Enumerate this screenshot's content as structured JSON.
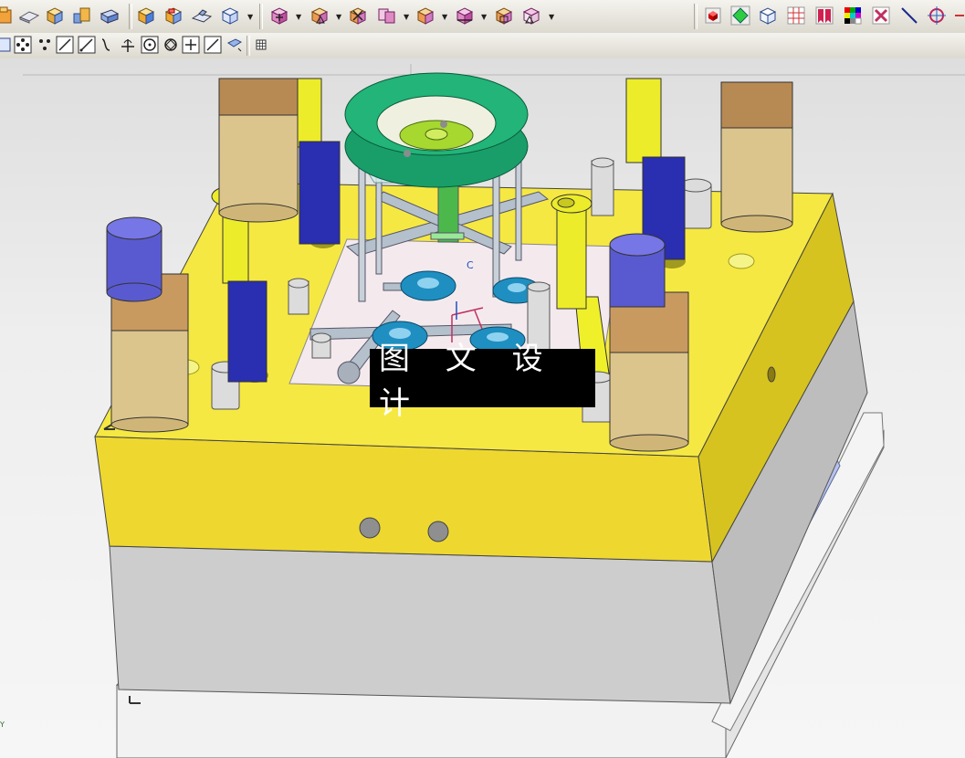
{
  "toolbar_top": {
    "groups": [
      {
        "name": "modeling",
        "icons": [
          "extrude-icon",
          "plane-icon",
          "block-icon",
          "assembly-icon",
          "shell-icon"
        ]
      },
      {
        "name": "features",
        "icons": [
          "box-solid-icon",
          "box-cut-icon",
          "chamfer-icon",
          "sphere-wire-icon"
        ]
      },
      {
        "name": "mold-tools",
        "icons": [
          "mold-move-icon",
          "mold-section-icon",
          "mold-trim-icon",
          "mold-copy-icon",
          "mold-split-icon",
          "mold-measure-icon",
          "mold-pocket-icon",
          "mold-triangle-icon"
        ]
      },
      {
        "name": "view",
        "icons": [
          "red-cube-icon",
          "green-diamond-icon",
          "white-cube-icon",
          "grid-icon",
          "bookmark-icon",
          "color-palette-icon",
          "layout-icon",
          "line-icon",
          "crosshair-icon"
        ]
      }
    ]
  },
  "toolbar_second": {
    "icons": [
      "cube-icon",
      "points-icon",
      "line-icon",
      "line-arrow-icon",
      "curve-icon",
      "perpendicular-icon",
      "circle-point-icon",
      "diamond-icon",
      "plus-icon",
      "slash-icon",
      "tag-icon",
      "grid-icon"
    ]
  },
  "viewport": {
    "watermark_text": "图 文 设 计",
    "axis_label_c": "C",
    "corner_axis_label": "Y"
  },
  "colors": {
    "plate_top": "#f6e842",
    "plate_front": "#eed830",
    "plate_side": "#d7c31f",
    "lower_block": "#c9c9c9",
    "lower_block_side": "#b3b3b3",
    "base_plate": "#f2f2f2",
    "cavity_glass": "#e6f4f4",
    "ring": "#199e6a",
    "leader_pin_tan": "#dcc58c",
    "leader_pin_blue": "#3b47b8",
    "ejector_yellow": "#ecec2a",
    "ejector_blue": "#2a2eb0",
    "screw": "#d9d9d9",
    "gear": "#1e8fc0"
  }
}
